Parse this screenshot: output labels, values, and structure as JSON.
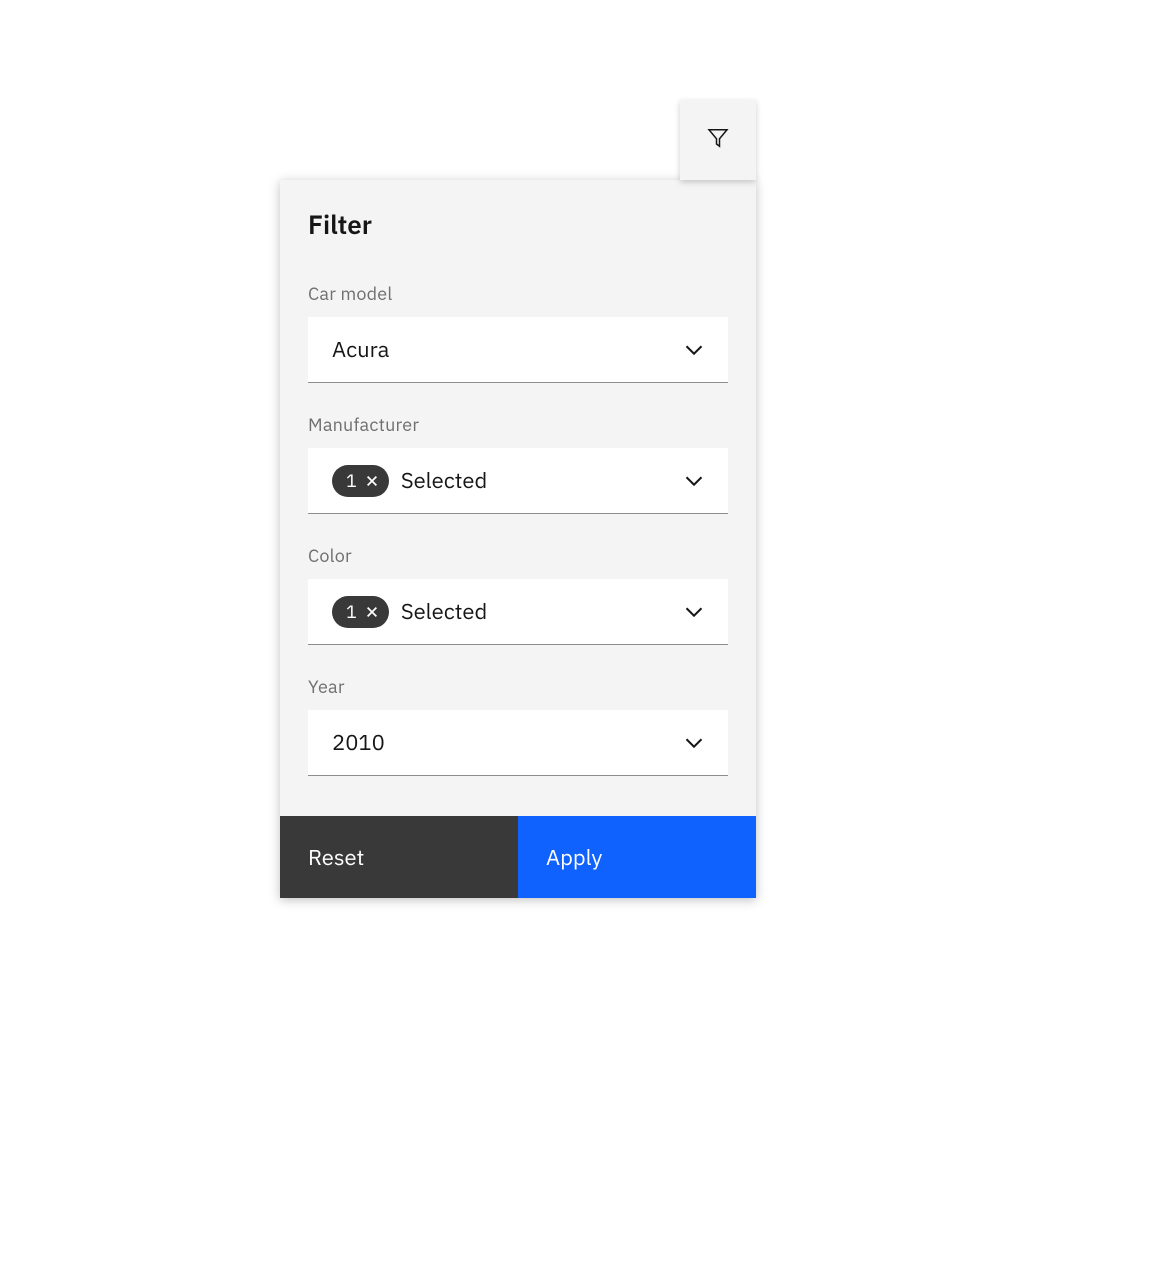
{
  "panel": {
    "title": "Filter",
    "fields": {
      "car_model": {
        "label": "Car model",
        "value": "Acura"
      },
      "manufacturer": {
        "label": "Manufacturer",
        "count": "1",
        "text": "Selected"
      },
      "color": {
        "label": "Color",
        "count": "1",
        "text": "Selected"
      },
      "year": {
        "label": "Year",
        "value": "2010"
      }
    },
    "actions": {
      "reset": "Reset",
      "apply": "Apply"
    }
  }
}
